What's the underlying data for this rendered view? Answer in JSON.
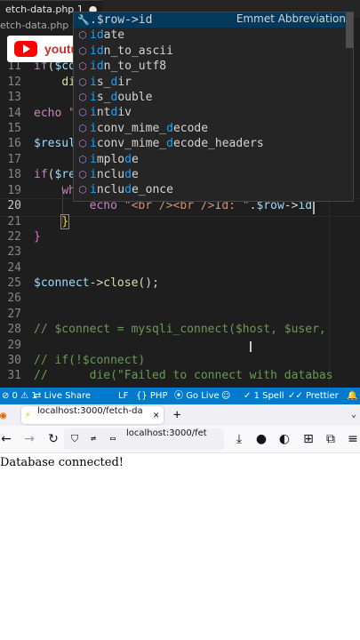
{
  "editor": {
    "tab_label": "etch-data.php 1",
    "tab_dirty": "●",
    "breadcrumb": "etch-data.php > ...",
    "lines": [
      {
        "n": "11",
        "text": "if($co"
      },
      {
        "n": "12",
        "text": "    di"
      },
      {
        "n": "13",
        "text": ""
      },
      {
        "n": "14",
        "text": "echo \""
      },
      {
        "n": "15",
        "text": ""
      },
      {
        "n": "16",
        "text": "$resul"
      },
      {
        "n": "17",
        "text": ""
      },
      {
        "n": "18",
        "text": "if($re"
      },
      {
        "n": "19",
        "text": "    wh"
      },
      {
        "n": "20",
        "text": "        echo \"<br /><br />Id: \".$row->id"
      },
      {
        "n": "21",
        "text": "    }"
      },
      {
        "n": "22",
        "text": "}"
      },
      {
        "n": "23",
        "text": ""
      },
      {
        "n": "24",
        "text": ""
      },
      {
        "n": "25",
        "text": "$connect->close();"
      },
      {
        "n": "26",
        "text": ""
      },
      {
        "n": "27",
        "text": ""
      },
      {
        "n": "28",
        "text": "// $connect = mysqli_connect($host, $user,"
      },
      {
        "n": "29",
        "text": ""
      },
      {
        "n": "30",
        "text": "// if(!$connect)"
      },
      {
        "n": "31",
        "text": "//      die(\"Failed to connect with databas"
      }
    ],
    "active_line": "20"
  },
  "overlay": {
    "youtube_text": "youtube.com/Geekboots"
  },
  "suggest": {
    "items": [
      {
        "icon": "🔧",
        "label": ".$row->id",
        "detail": "Emmet Abbreviation",
        "selected": true
      },
      {
        "icon": "⬡",
        "label": "idate"
      },
      {
        "icon": "⬡",
        "label": "idn_to_ascii"
      },
      {
        "icon": "⬡",
        "label": "idn_to_utf8"
      },
      {
        "icon": "⬡",
        "label": "is_dir"
      },
      {
        "icon": "⬡",
        "label": "is_double"
      },
      {
        "icon": "⬡",
        "label": "intdiv"
      },
      {
        "icon": "⬡",
        "label": "iconv_mime_decode"
      },
      {
        "icon": "⬡",
        "label": "iconv_mime_decode_headers"
      },
      {
        "icon": "⬡",
        "label": "implode"
      },
      {
        "icon": "⬡",
        "label": "include"
      },
      {
        "icon": "⬡",
        "label": "include_once"
      }
    ]
  },
  "status": {
    "problems": "⊘ 0 ⚠ 1",
    "live_share": "Live Share",
    "eol": "LF",
    "language": "PHP",
    "go_live": "Go Live",
    "spell": "1 Spell",
    "prettier": "Prettier"
  },
  "browser": {
    "tab_title": "localhost:3000/fetch-da",
    "url": "localhost:3000/fet",
    "page_text": "Database connected!"
  }
}
